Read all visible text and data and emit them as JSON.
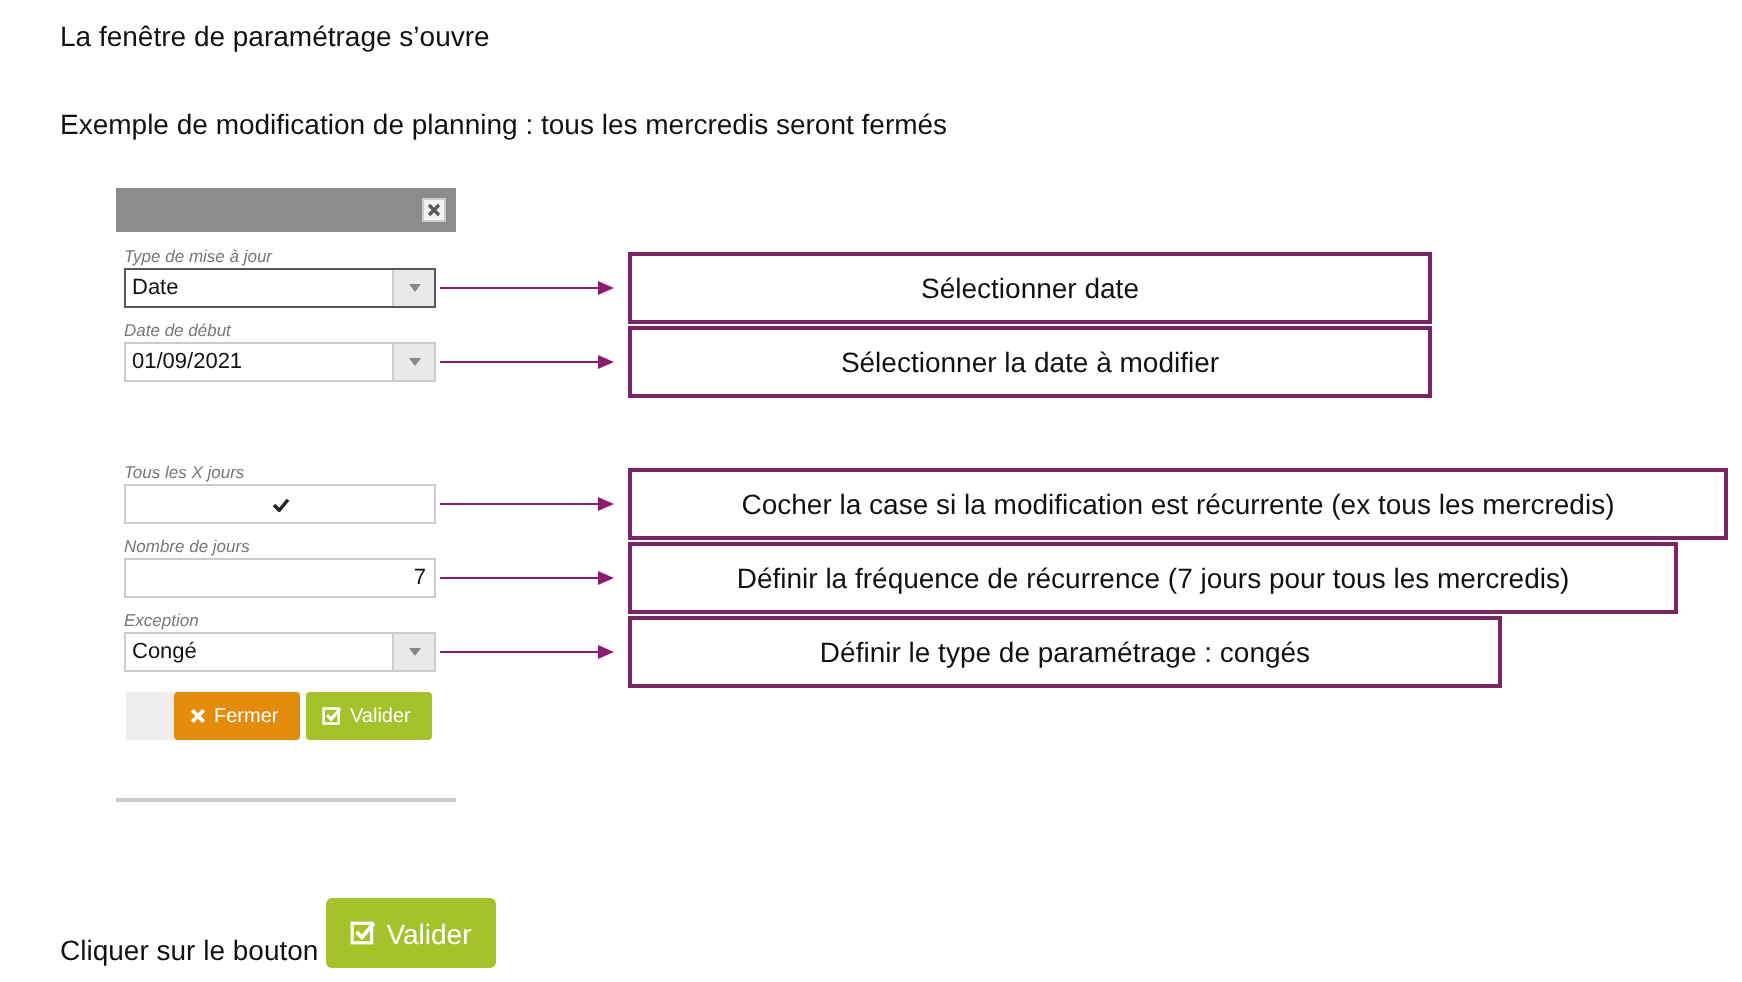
{
  "paragraphs": [
    "La fenêtre de paramétrage s’ouvre",
    "Exemple de modification de planning : tous les mercredis seront fermés"
  ],
  "dialog": {
    "fields": [
      {
        "kind": "select",
        "label": "Type de mise à jour",
        "value": "Date",
        "focused": true,
        "callout": "Sélectionner date"
      },
      {
        "kind": "select",
        "label": "Date de début",
        "value": "01/09/2021",
        "focused": false,
        "callout": "Sélectionner la date à modifier"
      },
      {
        "kind": "checkbox",
        "label": "Tous les X jours",
        "checked": true,
        "callout": "Cocher la case si la modification est récurrente (ex tous les mercredis)"
      },
      {
        "kind": "number",
        "label": "Nombre de jours",
        "value": "7",
        "callout": "Définir la fréquence de récurrence (7 jours pour tous les mercredis)"
      },
      {
        "kind": "select",
        "label": "Exception",
        "value": "Congé",
        "focused": false,
        "callout": "Définir le type de paramétrage : congés"
      }
    ],
    "buttons": [
      {
        "kind": "close",
        "label": "Fermer"
      },
      {
        "kind": "confirm",
        "label": "Valider"
      }
    ]
  },
  "footer": {
    "text": "Cliquer sur le bouton",
    "button": "Valider"
  }
}
